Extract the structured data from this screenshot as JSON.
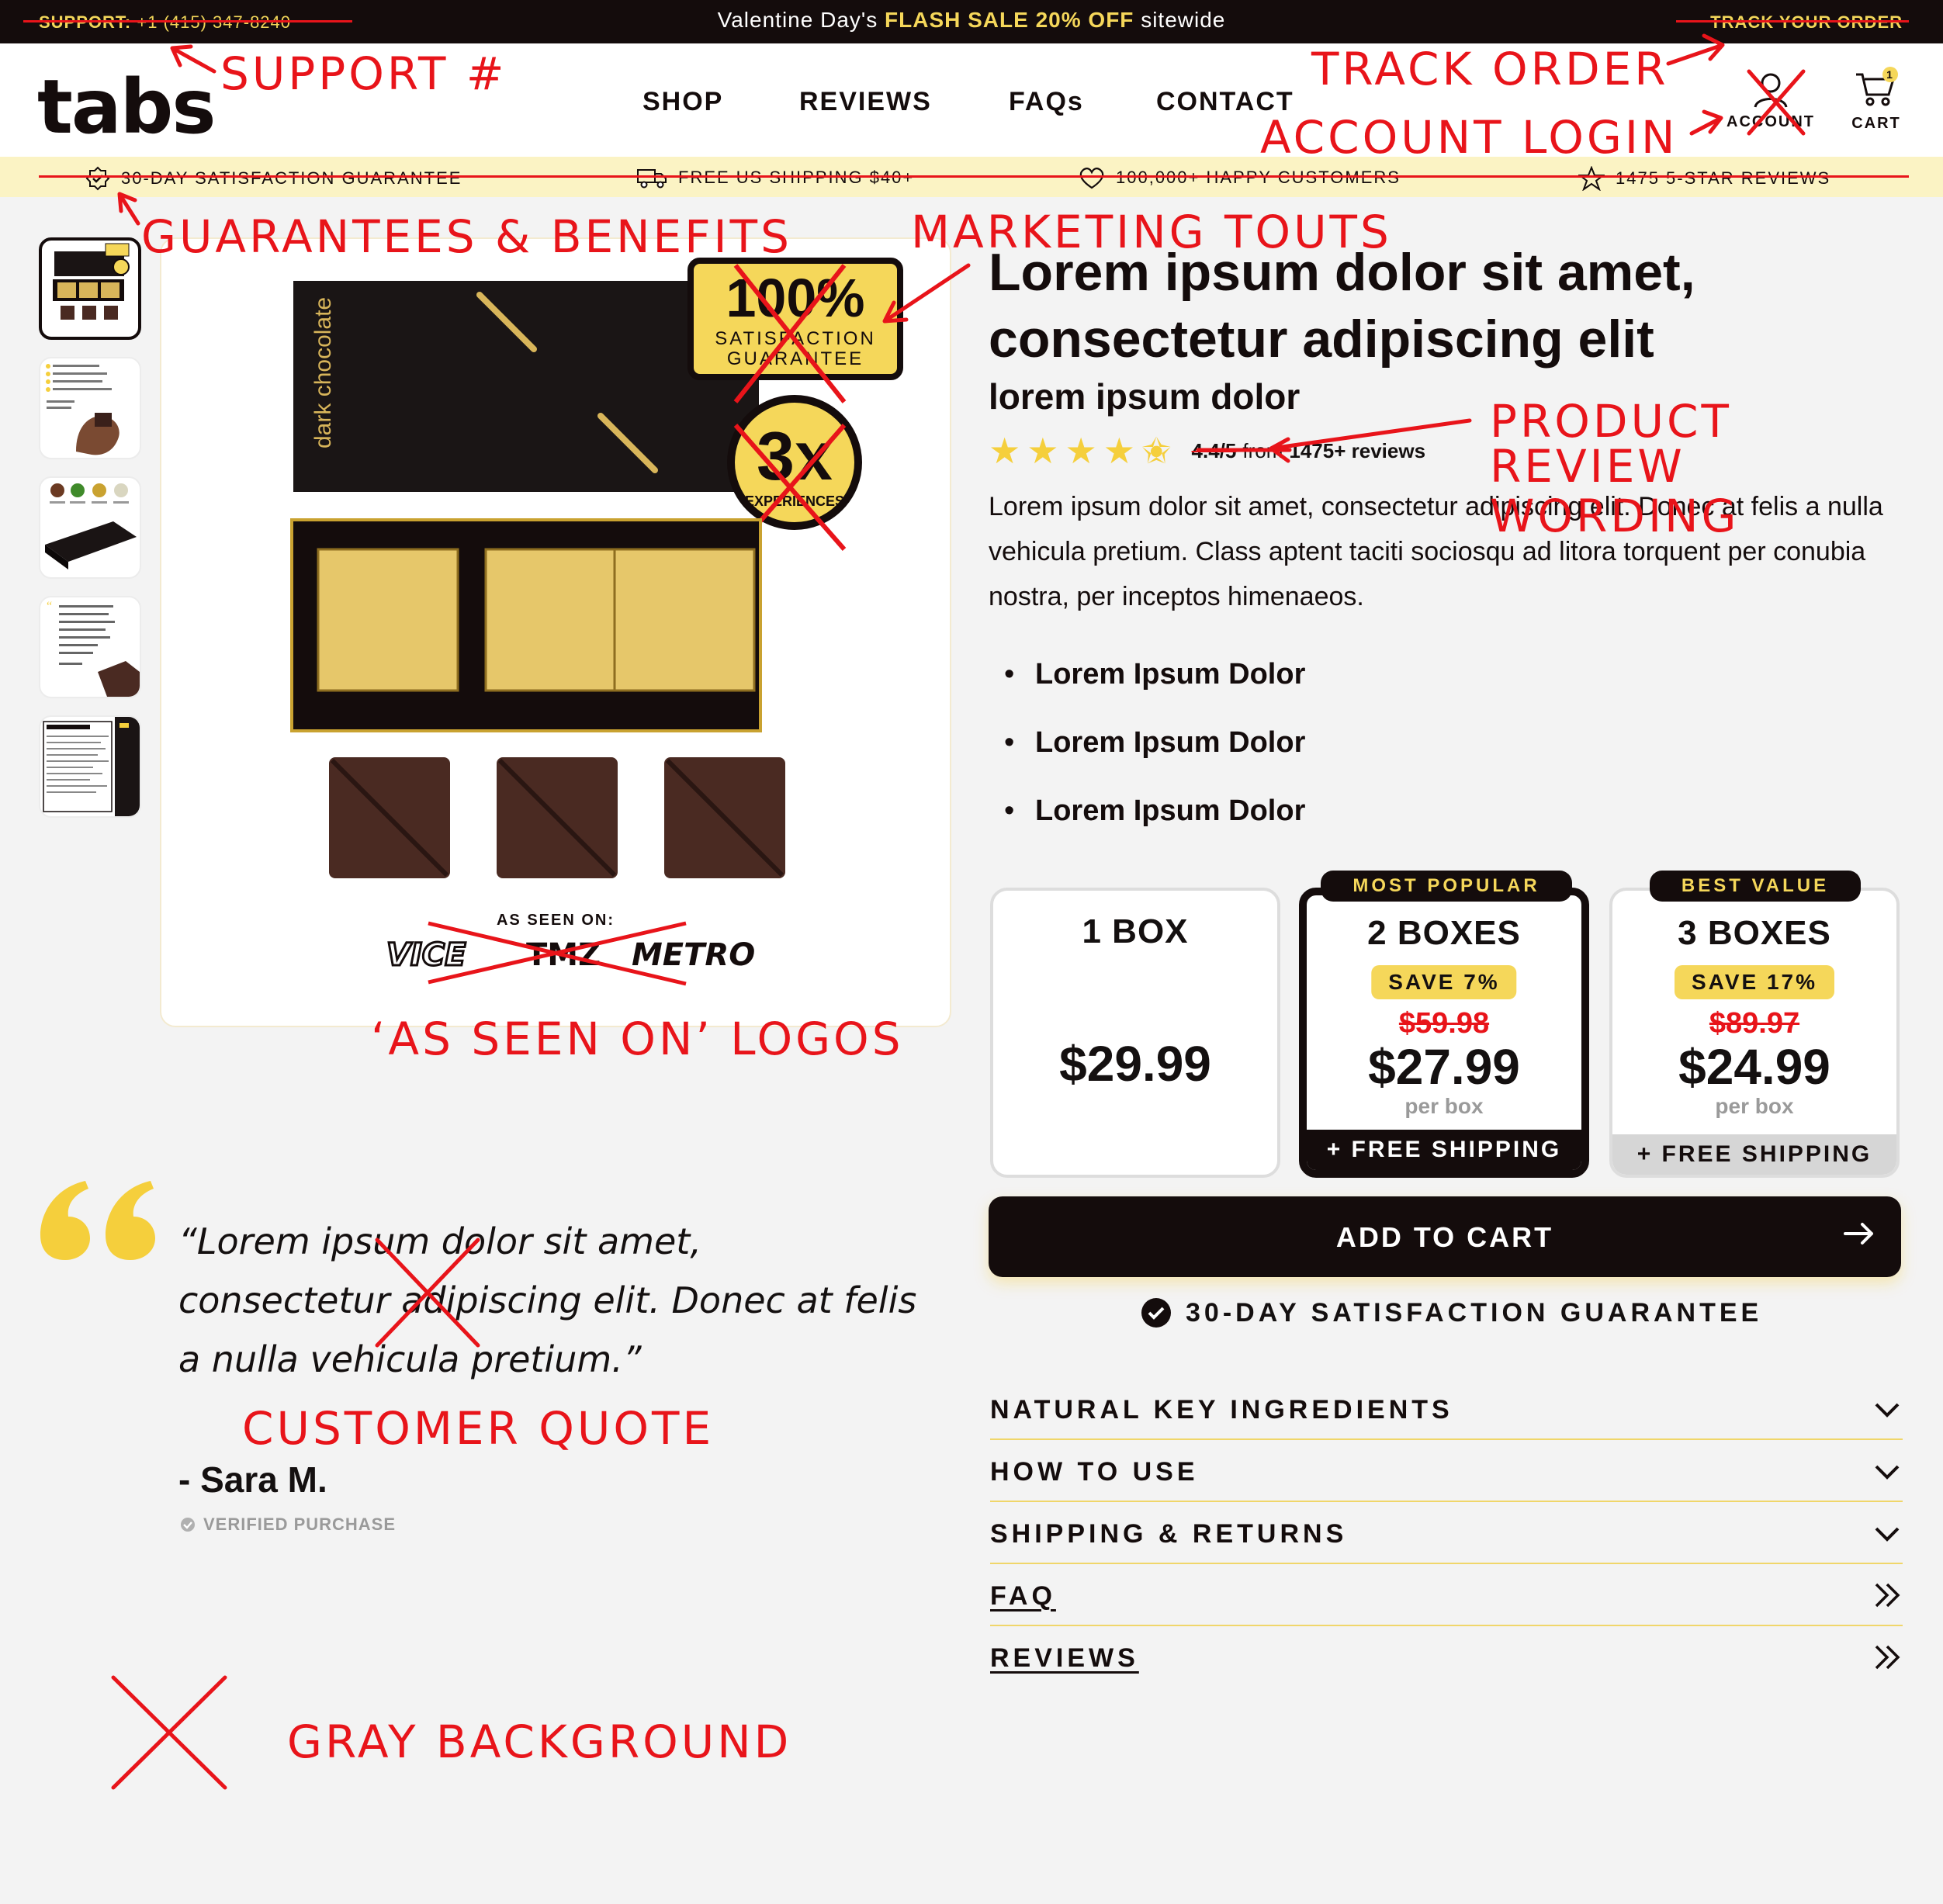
{
  "topbar": {
    "support_label": "SUPPORT:",
    "support_phone": "+1 (415) 347-8240",
    "promo_prefix": "Valentine Day's",
    "promo_highlight": "FLASH SALE 20% OFF",
    "promo_suffix": "sitewide",
    "track_label": "TRACK YOUR ORDER"
  },
  "header": {
    "logo": "tabs",
    "nav": [
      "SHOP",
      "REVIEWS",
      "FAQs",
      "CONTACT"
    ],
    "account_label": "ACCOUNT",
    "cart_label": "CART",
    "cart_count": "1"
  },
  "benefits": [
    {
      "icon": "badge-check-icon",
      "text": "30-DAY SATISFACTION GUARANTEE"
    },
    {
      "icon": "truck-icon",
      "text": "FREE US SHIPPING $40+"
    },
    {
      "icon": "heart-icon",
      "text": "100,000+ HAPPY CUSTOMERS"
    },
    {
      "icon": "star-outline-icon",
      "text": "1475 5-STAR REVIEWS"
    }
  ],
  "gallery": {
    "box_text": "dark chocolate",
    "seal_big": "100%",
    "seal_line1": "SATISFACTION",
    "seal_line2": "GUARANTEE",
    "badge_big": "3x",
    "badge_small": "EXPERIENCES",
    "as_seen_on": "AS SEEN ON:",
    "logos": [
      "VICE",
      "TMZ",
      "METRO"
    ]
  },
  "product": {
    "title": "Lorem ipsum dolor sit amet, consectetur adipiscing elit",
    "subtitle": "lorem ipsum dolor",
    "rating_text": "4.4/5",
    "rating_from": "from",
    "reviews_count": "1475+ reviews",
    "rating_value": 4.4,
    "description": "Lorem ipsum dolor sit amet, consectetur adipiscing elit. Donec at felis a nulla vehicula pretium. Class aptent taciti sociosqu ad litora torquent per conubia nostra, per inceptos himenaeos.",
    "bullets": [
      "Lorem Ipsum Dolor",
      "Lorem Ipsum Dolor",
      "Lorem Ipsum Dolor"
    ]
  },
  "bundles": [
    {
      "name": "1 BOX",
      "price": "$29.99"
    },
    {
      "badge": "MOST POPULAR",
      "name": "2 BOXES",
      "save": "SAVE 7%",
      "old_price": "$59.98",
      "price": "$27.99",
      "per": "per box",
      "shipping": "+ FREE SHIPPING"
    },
    {
      "badge": "BEST VALUE",
      "name": "3 BOXES",
      "save": "SAVE 17%",
      "old_price": "$89.97",
      "price": "$24.99",
      "per": "per box",
      "shipping": "+ FREE SHIPPING"
    }
  ],
  "cart": {
    "add_label": "ADD TO CART",
    "guarantee": "30-DAY SATISFACTION GUARANTEE"
  },
  "accordion": [
    {
      "label": "NATURAL KEY INGREDIENTS",
      "icon": "chevron-down-icon"
    },
    {
      "label": "HOW TO USE",
      "icon": "chevron-down-icon"
    },
    {
      "label": "SHIPPING & RETURNS",
      "icon": "chevron-down-icon"
    },
    {
      "label": "FAQ",
      "icon": "double-chevron-right-icon"
    },
    {
      "label": "REVIEWS",
      "icon": "double-chevron-right-icon"
    }
  ],
  "testimonial": {
    "quote": "“Lorem ipsum dolor sit amet, consectetur adipiscing elit. Donec at felis a nulla vehicula pretium.”",
    "author": "- Sara M.",
    "verified": "VERIFIED PURCHASE"
  },
  "annotations": {
    "support": "SUPPORT #",
    "track": "TRACK ORDER",
    "account": "ACCOUNT LOGIN",
    "guarantees": "GUARANTEES & BENEFITS",
    "touts": "MARKETING TOUTS",
    "review_line1": "PRODUCT",
    "review_line2": "REVIEW",
    "review_line3": "WORDING",
    "logos": "‘AS SEEN ON’ LOGOS",
    "quote": "CUSTOMER QUOTE",
    "gray": "GRAY BACKGROUND"
  },
  "colors": {
    "dark": "#140c0c",
    "accent_yellow": "#f5d75a",
    "strip_yellow": "#fbf3c4",
    "annotation_red": "#e8141a",
    "page_gray": "#f3f3f3"
  }
}
